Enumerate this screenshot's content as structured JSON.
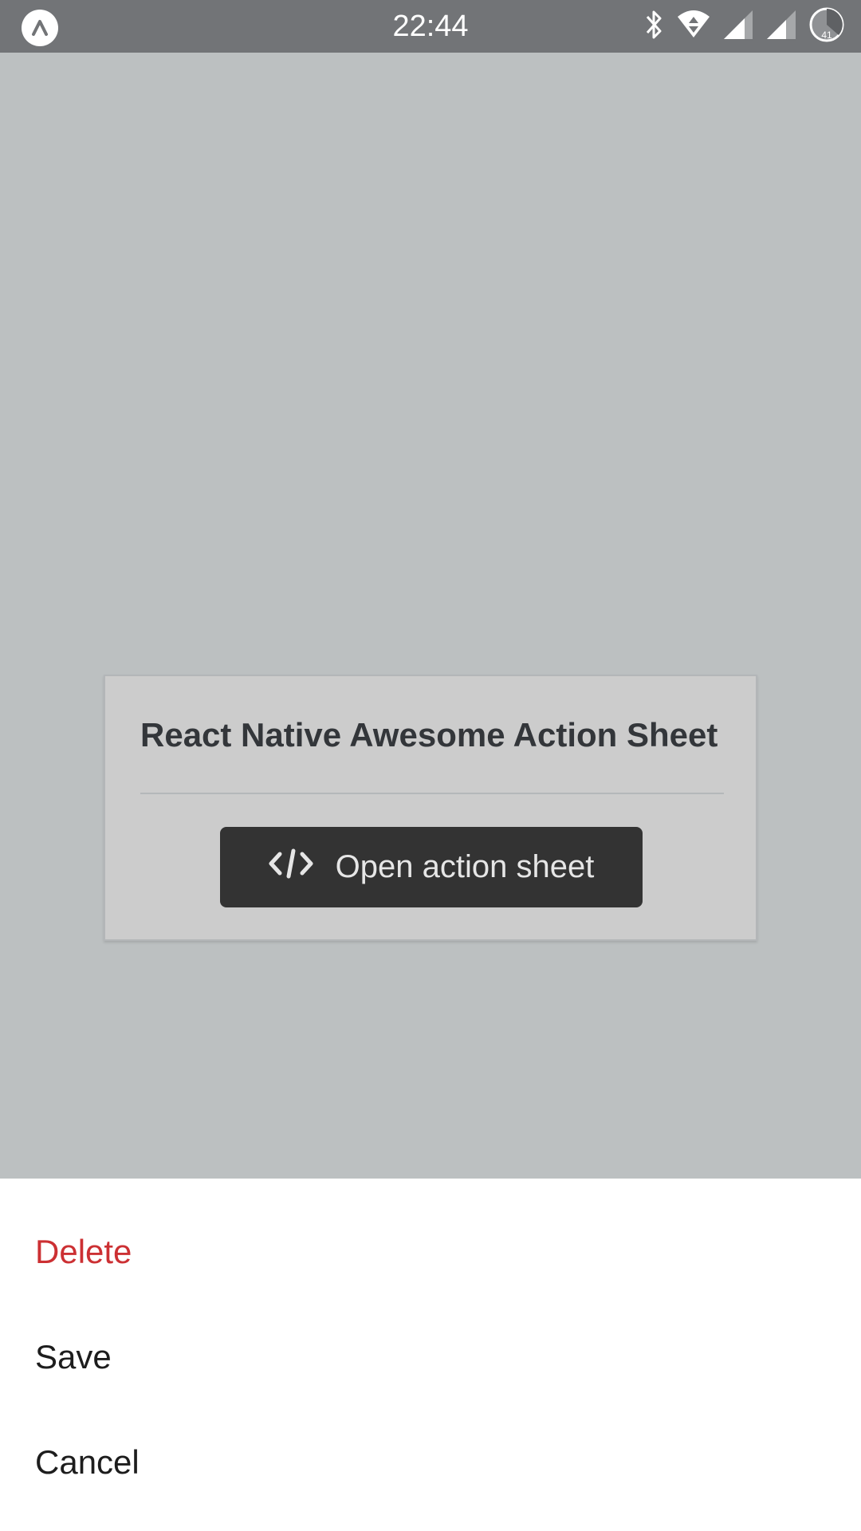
{
  "status_bar": {
    "time": "22:44",
    "battery_level": "41",
    "icons": [
      "app-logo-icon",
      "bluetooth-icon",
      "wifi-icon",
      "signal-icon",
      "signal-icon",
      "battery-icon"
    ]
  },
  "card": {
    "title": "React Native Awesome Action Sheet",
    "button": {
      "label": "Open action sheet",
      "icon": "code-icon"
    }
  },
  "action_sheet": {
    "items": [
      {
        "label": "Delete",
        "destructive": true,
        "color": "#cc3033"
      },
      {
        "label": "Save",
        "destructive": false,
        "color": "#1d1d1d"
      },
      {
        "label": "Cancel",
        "destructive": false,
        "color": "#1d1d1d"
      }
    ]
  },
  "colors": {
    "overlay": "#bcc0c1",
    "status_bar": "#727477",
    "card": "#cccccc",
    "button": "#333333",
    "destructive": "#cc3033"
  }
}
